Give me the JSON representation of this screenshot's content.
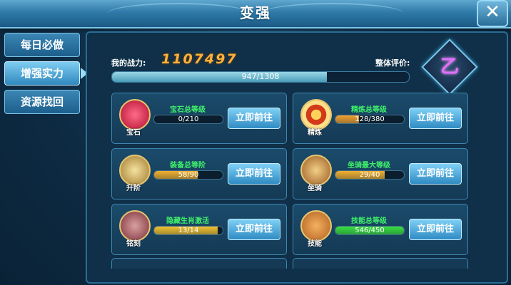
{
  "window": {
    "title": "变强",
    "close_glyph": "✕"
  },
  "sidebar": {
    "items": [
      {
        "label": "每日必做"
      },
      {
        "label": "增强实力"
      },
      {
        "label": "资源找回"
      }
    ],
    "active_index": 1
  },
  "power": {
    "label": "我的战力:",
    "value": "1107497",
    "progress_text": "947/1308",
    "progress_fraction": 0.724
  },
  "rating": {
    "label": "整体评价:",
    "grade": "乙"
  },
  "cards": [
    {
      "icon": "gem-icon",
      "icon_label": "宝石",
      "title": "宝石总等级",
      "progress_text": "0/210",
      "fraction": 0.0,
      "bar_color": "#e0b040",
      "button": "立即前往"
    },
    {
      "icon": "target-icon",
      "icon_label": "精炼",
      "title": "精炼总等级",
      "progress_text": "128/380",
      "fraction": 0.34,
      "bar_color": "#f0a030",
      "button": "立即前往"
    },
    {
      "icon": "armor-icon",
      "icon_label": "升阶",
      "title": "装备总等阶",
      "progress_text": "58/90",
      "fraction": 0.64,
      "bar_color": "#f0b030",
      "button": "立即前往"
    },
    {
      "icon": "mount-icon",
      "icon_label": "坐骑",
      "title": "坐骑最大等级",
      "progress_text": "29/40",
      "fraction": 0.72,
      "bar_color": "#f0b030",
      "button": "立即前往"
    },
    {
      "icon": "zodiac-icon",
      "icon_label": "铭刻",
      "title": "隐藏生肖激活",
      "progress_text": "13/14",
      "fraction": 0.93,
      "bar_color": "#f0c030",
      "button": "立即前往"
    },
    {
      "icon": "book-icon",
      "icon_label": "技能",
      "title": "技能总等级",
      "progress_text": "546/450",
      "fraction": 1.0,
      "bar_color": "#3adf40",
      "button": "立即前往"
    }
  ]
}
